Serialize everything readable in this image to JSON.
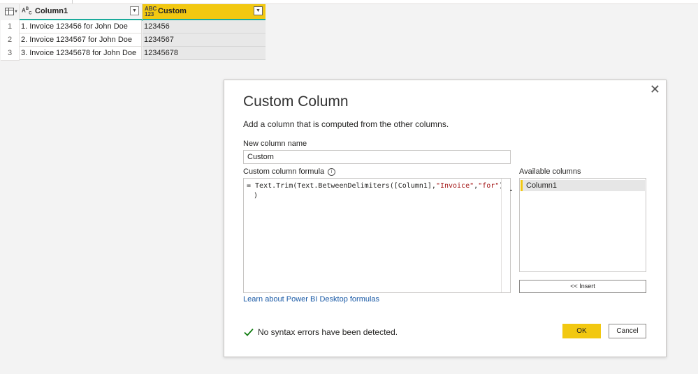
{
  "grid": {
    "columns": [
      {
        "type_icon": "ABC",
        "name": "Column1"
      },
      {
        "type_icon": "ABC 123",
        "name": "Custom"
      }
    ],
    "rows": [
      {
        "num": "1",
        "column1": "1. Invoice 123456 for John Doe",
        "custom": "123456"
      },
      {
        "num": "2",
        "column1": "2. Invoice 1234567 for John Doe",
        "custom": "1234567"
      },
      {
        "num": "3",
        "column1": "3. Invoice 12345678 for John Doe",
        "custom": "12345678"
      }
    ],
    "accent_color": "#1aaa9b",
    "selected_column_color": "#f2c811"
  },
  "dialog": {
    "title": "Custom Column",
    "description": "Add a column that is computed from the other columns.",
    "new_column_name_label": "New column name",
    "new_column_name_value": "Custom",
    "formula_label": "Custom column formula",
    "formula_line1_prefix": "= Text.Trim(Text.BetweenDelimiters([Column1],",
    "formula_str1": "\"Invoice\"",
    "formula_comma": ",",
    "formula_str2": "\"for\"",
    "formula_line1_suffix": ")",
    "formula_line2": ")",
    "available_columns_label": "Available columns",
    "available_columns": [
      "Column1"
    ],
    "insert_label": "<< Insert",
    "learn_link": "Learn about Power BI Desktop formulas",
    "status": "No syntax errors have been detected.",
    "ok_label": "OK",
    "cancel_label": "Cancel",
    "close_glyph": "✕",
    "icons": [
      "close-icon",
      "info-icon",
      "check-icon",
      "table-icon",
      "dropdown-icon"
    ]
  }
}
